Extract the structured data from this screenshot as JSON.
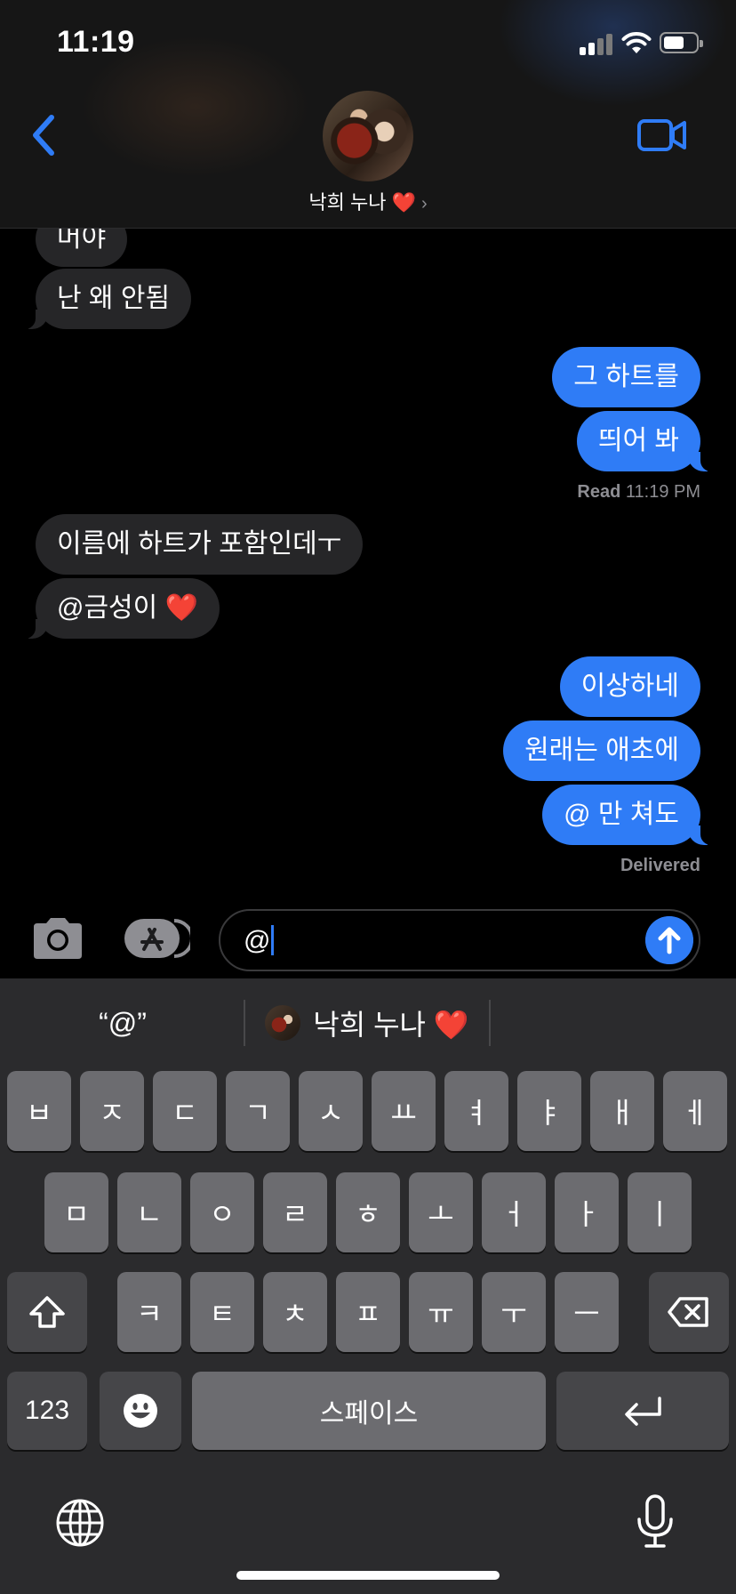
{
  "status_bar": {
    "time": "11:19"
  },
  "header": {
    "contact_name": "낙희 누나 ❤️",
    "chevron": "›"
  },
  "messages": [
    {
      "text": "머야"
    },
    {
      "text": "난 왜 안됨"
    },
    {
      "text": "그 하트를"
    },
    {
      "text": "띄어 봐"
    },
    {
      "text": "이름에 하트가 포함인데ㅜ"
    },
    {
      "text": "@금성이 ❤️"
    },
    {
      "text": "이상하네"
    },
    {
      "text": "원래는 애초에"
    },
    {
      "text": "@ 만 쳐도"
    }
  ],
  "receipts": {
    "read_label": "Read",
    "read_time": "11:19 PM",
    "delivered": "Delivered"
  },
  "input": {
    "value": "@"
  },
  "suggestions": {
    "first": "“@”",
    "second": "낙희 누나 ❤️"
  },
  "keyboard": {
    "row1": [
      "ㅂ",
      "ㅈ",
      "ㄷ",
      "ㄱ",
      "ㅅ",
      "ㅛ",
      "ㅕ",
      "ㅑ",
      "ㅐ",
      "ㅔ"
    ],
    "row2": [
      "ㅁ",
      "ㄴ",
      "ㅇ",
      "ㄹ",
      "ㅎ",
      "ㅗ",
      "ㅓ",
      "ㅏ",
      "ㅣ"
    ],
    "row3": [
      "ㅋ",
      "ㅌ",
      "ㅊ",
      "ㅍ",
      "ㅠ",
      "ㅜ",
      "ㅡ"
    ],
    "numbers_label": "123",
    "space_label": "스페이스"
  },
  "icons": [
    "back-icon",
    "video-call-icon",
    "camera-icon",
    "app-store-icon",
    "send-arrow-icon",
    "shift-icon",
    "delete-icon",
    "emoji-icon",
    "return-icon",
    "globe-icon",
    "microphone-icon",
    "wifi-icon",
    "battery-icon",
    "signal-icon"
  ],
  "colors": {
    "accent": "#2f7cf6",
    "incoming_bubble": "#262628",
    "keyboard_bg": "#2b2b2d",
    "key": "#6c6c70",
    "key_dark": "#464649"
  }
}
